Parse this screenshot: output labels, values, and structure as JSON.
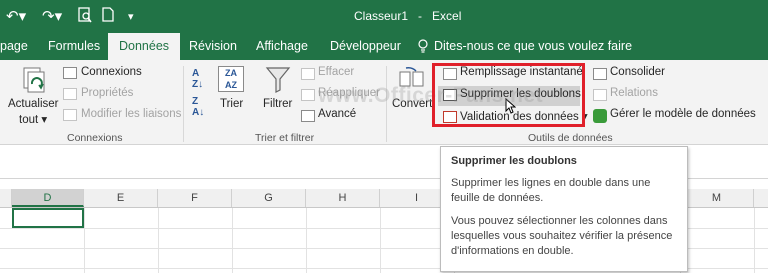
{
  "titlebar": {
    "document": "Classeur1",
    "separator": "-",
    "app": "Excel",
    "bg": "#217346"
  },
  "tabs": [
    {
      "label": "page",
      "active": false
    },
    {
      "label": "Formules",
      "active": false
    },
    {
      "label": "Données",
      "active": true
    },
    {
      "label": "Révision",
      "active": false
    },
    {
      "label": "Affichage",
      "active": false
    },
    {
      "label": "Développeur",
      "active": false
    }
  ],
  "tell_me": "Dites-nous ce que vous voulez faire",
  "ribbon": {
    "refresh": {
      "line1": "Actualiser",
      "line2": "tout"
    },
    "connexions": "Connexions",
    "proprietes": "Propriétés",
    "modifier_liaisons": "Modifier les liaisons",
    "group_connexions": "Connexions",
    "trier": "Trier",
    "filtrer": "Filtrer",
    "effacer": "Effacer",
    "reappliquer": "Réappliquer",
    "avance": "Avancé",
    "group_trier": "Trier et filtrer",
    "convertir": "Convert",
    "remplissage": "Remplissage instantané",
    "supprimer_doublons": "Supprimer les doublons",
    "validation": "Validation des données",
    "group_outils": "Outils de données",
    "consolider": "Consolider",
    "relations": "Relations",
    "gerer_modele": "Gérer le modèle de données"
  },
  "watermark": "www.Officer-Fans.net",
  "columns": [
    "D",
    "E",
    "F",
    "G",
    "H",
    "I",
    "M"
  ],
  "tooltip": {
    "title": "Supprimer les doublons",
    "p1": "Supprimer les lignes en double dans une feuille de données.",
    "p2": "Vous pouvez sélectionner les colonnes dans lesquelles vous souhaitez vérifier la présence d'informations en double."
  },
  "colors": {
    "accent": "#217346",
    "highlight": "#e0202a"
  }
}
